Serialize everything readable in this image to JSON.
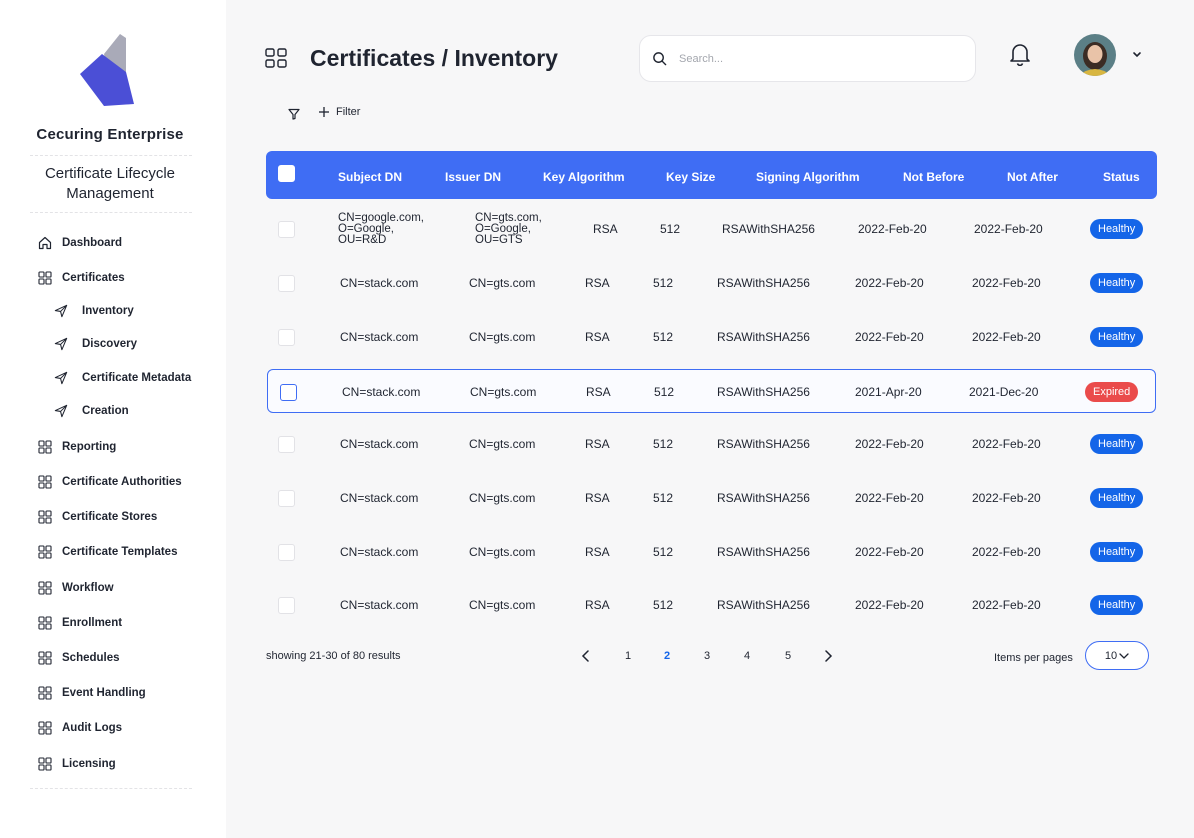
{
  "sidebar": {
    "brand": "Cecuring Enterprise",
    "module_title": "Certificate Lifecycle Management",
    "items": [
      {
        "label": "Dashboard",
        "icon": "home-icon"
      },
      {
        "label": "Certificates",
        "icon": "grid-icon"
      },
      {
        "label": "Inventory",
        "icon": "send-icon"
      },
      {
        "label": "Discovery",
        "icon": "send-icon"
      },
      {
        "label": "Certificate Metadata",
        "icon": "send-icon"
      },
      {
        "label": "Creation",
        "icon": "send-icon"
      },
      {
        "label": "Reporting",
        "icon": "grid-icon"
      },
      {
        "label": "Certificate Authorities",
        "icon": "grid-icon"
      },
      {
        "label": "Certificate Stores",
        "icon": "grid-icon"
      },
      {
        "label": "Certificate Templates",
        "icon": "grid-icon"
      },
      {
        "label": "Workflow",
        "icon": "grid-icon"
      },
      {
        "label": "Enrollment",
        "icon": "grid-icon"
      },
      {
        "label": "Schedules",
        "icon": "grid-icon"
      },
      {
        "label": "Event Handling",
        "icon": "grid-icon"
      },
      {
        "label": "Audit Logs",
        "icon": "grid-icon"
      },
      {
        "label": "Licensing",
        "icon": "grid-icon"
      }
    ]
  },
  "header": {
    "title": "Certificates / Inventory",
    "search_placeholder": "Search...",
    "filter_label": "Filter"
  },
  "table": {
    "columns": [
      "Subject DN",
      "Issuer DN",
      "Key Algorithm",
      "Key Size",
      "Signing Algorithm",
      "Not Before",
      "Not After",
      "Status"
    ],
    "rows": [
      {
        "subject": [
          "CN=google.com,",
          "O=Google,",
          "OU=R&D"
        ],
        "issuer": [
          "CN=gts.com,",
          "O=Google,",
          "OU=GTS"
        ],
        "algo": "RSA",
        "size": "512",
        "signing": "RSAWithSHA256",
        "not_before": "2022-Feb-20",
        "not_after": "2022-Feb-20",
        "status": "Healthy"
      },
      {
        "subject": "CN=stack.com",
        "issuer": "CN=gts.com",
        "algo": "RSA",
        "size": "512",
        "signing": "RSAWithSHA256",
        "not_before": "2022-Feb-20",
        "not_after": "2022-Feb-20",
        "status": "Healthy"
      },
      {
        "subject": "CN=stack.com",
        "issuer": "CN=gts.com",
        "algo": "RSA",
        "size": "512",
        "signing": "RSAWithSHA256",
        "not_before": "2022-Feb-20",
        "not_after": "2022-Feb-20",
        "status": "Healthy"
      },
      {
        "subject": "CN=stack.com",
        "issuer": "CN=gts.com",
        "algo": "RSA",
        "size": "512",
        "signing": "RSAWithSHA256",
        "not_before": "2021-Apr-20",
        "not_after": "2021-Dec-20",
        "status": "Expired"
      },
      {
        "subject": "CN=stack.com",
        "issuer": "CN=gts.com",
        "algo": "RSA",
        "size": "512",
        "signing": "RSAWithSHA256",
        "not_before": "2022-Feb-20",
        "not_after": "2022-Feb-20",
        "status": "Healthy"
      },
      {
        "subject": "CN=stack.com",
        "issuer": "CN=gts.com",
        "algo": "RSA",
        "size": "512",
        "signing": "RSAWithSHA256",
        "not_before": "2022-Feb-20",
        "not_after": "2022-Feb-20",
        "status": "Healthy"
      },
      {
        "subject": "CN=stack.com",
        "issuer": "CN=gts.com",
        "algo": "RSA",
        "size": "512",
        "signing": "RSAWithSHA256",
        "not_before": "2022-Feb-20",
        "not_after": "2022-Feb-20",
        "status": "Healthy"
      },
      {
        "subject": "CN=stack.com",
        "issuer": "CN=gts.com",
        "algo": "RSA",
        "size": "512",
        "signing": "RSAWithSHA256",
        "not_before": "2022-Feb-20",
        "not_after": "2022-Feb-20",
        "status": "Healthy"
      }
    ]
  },
  "footer": {
    "showing": "showing 21-30 of 80 results",
    "pages": [
      "1",
      "2",
      "3",
      "4",
      "5"
    ],
    "current_page": "2",
    "items_per_page_label": "Items per pages",
    "items_per_page": "10"
  },
  "colors": {
    "accent": "#3f6df4",
    "healthy": "#1465e8",
    "expired": "#ea4b4b",
    "logo_primary": "#4b4fd6",
    "logo_secondary": "#a9aab8"
  }
}
